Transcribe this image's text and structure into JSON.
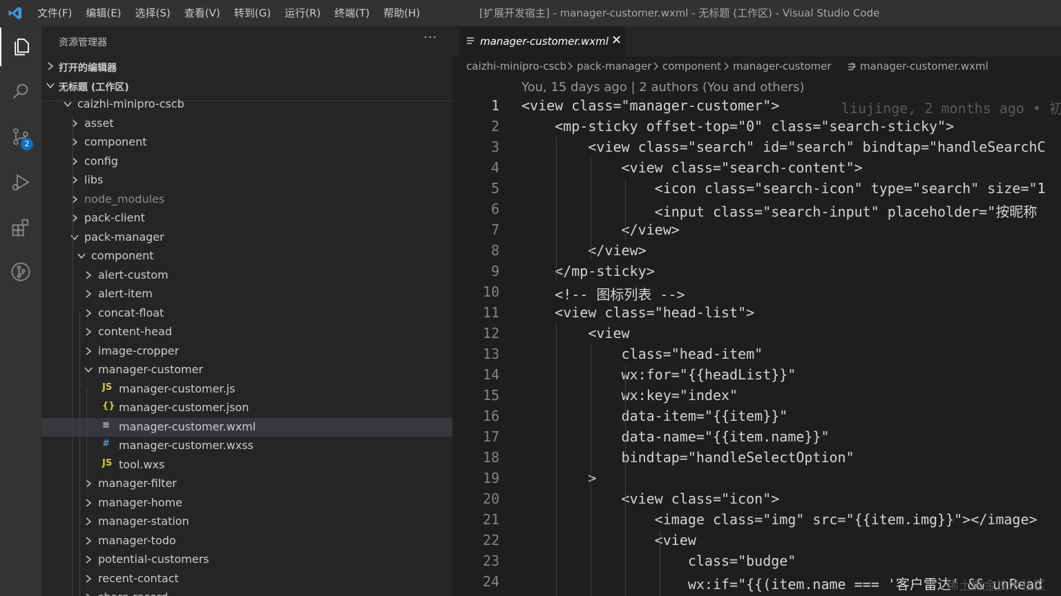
{
  "titlebar": {
    "menus": [
      "文件(F)",
      "编辑(E)",
      "选择(S)",
      "查看(V)",
      "转到(G)",
      "运行(R)",
      "终端(T)",
      "帮助(H)"
    ],
    "window_title": "[扩展开发宿主] - manager-customer.wxml - 无标题 (工作区) - Visual Studio Code"
  },
  "activity": {
    "items": [
      "explorer-icon",
      "search-icon",
      "source-control-icon",
      "run-debug-icon",
      "extensions-icon",
      "git-graph-icon"
    ],
    "source_control_badge": "2"
  },
  "sidebar": {
    "title": "资源管理器",
    "more": "···",
    "open_editors": "打开的编辑器",
    "workspace": "无标题 (工作区)",
    "tree": [
      {
        "label": "caizhi-minipro-cscb",
        "depth": 0,
        "kind": "folder",
        "open": true
      },
      {
        "label": "asset",
        "depth": 1,
        "kind": "folder",
        "open": false
      },
      {
        "label": "component",
        "depth": 1,
        "kind": "folder",
        "open": false
      },
      {
        "label": "config",
        "depth": 1,
        "kind": "folder",
        "open": false
      },
      {
        "label": "libs",
        "depth": 1,
        "kind": "folder",
        "open": false
      },
      {
        "label": "node_modules",
        "depth": 1,
        "kind": "folder",
        "open": false,
        "dim": true
      },
      {
        "label": "pack-client",
        "depth": 1,
        "kind": "folder",
        "open": false
      },
      {
        "label": "pack-manager",
        "depth": 1,
        "kind": "folder",
        "open": true
      },
      {
        "label": "component",
        "depth": 2,
        "kind": "folder",
        "open": true
      },
      {
        "label": "alert-custom",
        "depth": 3,
        "kind": "folder",
        "open": false
      },
      {
        "label": "alert-item",
        "depth": 3,
        "kind": "folder",
        "open": false
      },
      {
        "label": "concat-float",
        "depth": 3,
        "kind": "folder",
        "open": false
      },
      {
        "label": "content-head",
        "depth": 3,
        "kind": "folder",
        "open": false
      },
      {
        "label": "image-cropper",
        "depth": 3,
        "kind": "folder",
        "open": false
      },
      {
        "label": "manager-customer",
        "depth": 3,
        "kind": "folder",
        "open": true
      },
      {
        "label": "manager-customer.js",
        "depth": 4,
        "kind": "js"
      },
      {
        "label": "manager-customer.json",
        "depth": 4,
        "kind": "json"
      },
      {
        "label": "manager-customer.wxml",
        "depth": 4,
        "kind": "wxml",
        "selected": true
      },
      {
        "label": "manager-customer.wxss",
        "depth": 4,
        "kind": "wxss"
      },
      {
        "label": "tool.wxs",
        "depth": 4,
        "kind": "js"
      },
      {
        "label": "manager-filter",
        "depth": 3,
        "kind": "folder",
        "open": false
      },
      {
        "label": "manager-home",
        "depth": 3,
        "kind": "folder",
        "open": false
      },
      {
        "label": "manager-station",
        "depth": 3,
        "kind": "folder",
        "open": false
      },
      {
        "label": "manager-todo",
        "depth": 3,
        "kind": "folder",
        "open": false
      },
      {
        "label": "potential-customers",
        "depth": 3,
        "kind": "folder",
        "open": false
      },
      {
        "label": "recent-contact",
        "depth": 3,
        "kind": "folder",
        "open": false
      },
      {
        "label": "share-record",
        "depth": 3,
        "kind": "folder",
        "open": false
      }
    ]
  },
  "editor": {
    "tab": {
      "label": "manager-customer.wxml",
      "close": "✕"
    },
    "breadcrumb": [
      "caizhi-minipro-cscb",
      "pack-manager",
      "component",
      "manager-customer",
      "manager-customer.wxml"
    ],
    "codelens": "You, 15 days ago | 2 authors (You and others)",
    "blame": "liujinge, 2 months ago • 初",
    "lines": [
      {
        "n": "1",
        "text": "<view class=\"manager-customer\">"
      },
      {
        "n": "2",
        "text": "    <mp-sticky offset-top=\"0\" class=\"search-sticky\">"
      },
      {
        "n": "3",
        "text": "        <view class=\"search\" id=\"search\" bindtap=\"handleSearchC"
      },
      {
        "n": "4",
        "text": "            <view class=\"search-content\">"
      },
      {
        "n": "5",
        "text": "                <icon class=\"search-icon\" type=\"search\" size=\"1"
      },
      {
        "n": "6",
        "text": "                <input class=\"search-input\" placeholder=\"按昵称"
      },
      {
        "n": "7",
        "text": "            </view>"
      },
      {
        "n": "8",
        "text": "        </view>"
      },
      {
        "n": "9",
        "text": "    </mp-sticky>"
      },
      {
        "n": "10",
        "text": "    <!-- 图标列表 -->"
      },
      {
        "n": "11",
        "text": "    <view class=\"head-list\">"
      },
      {
        "n": "12",
        "text": "        <view"
      },
      {
        "n": "13",
        "text": "            class=\"head-item\""
      },
      {
        "n": "14",
        "text": "            wx:for=\"{{headList}}\""
      },
      {
        "n": "15",
        "text": "            wx:key=\"index\""
      },
      {
        "n": "16",
        "text": "            data-item=\"{{item}}\""
      },
      {
        "n": "17",
        "text": "            data-name=\"{{item.name}}\""
      },
      {
        "n": "18",
        "text": "            bindtap=\"handleSelectOption\""
      },
      {
        "n": "19",
        "text": "        >"
      },
      {
        "n": "20",
        "text": "            <view class=\"icon\">"
      },
      {
        "n": "21",
        "text": "                <image class=\"img\" src=\"{{item.img}}\"></image>"
      },
      {
        "n": "22",
        "text": "                <view"
      },
      {
        "n": "23",
        "text": "                    class=\"budge\""
      },
      {
        "n": "24",
        "text": "                    wx:if=\"{{(item.name === '客户雷达' && unRead"
      }
    ]
  },
  "watermark": "稀土掘金技术社区"
}
